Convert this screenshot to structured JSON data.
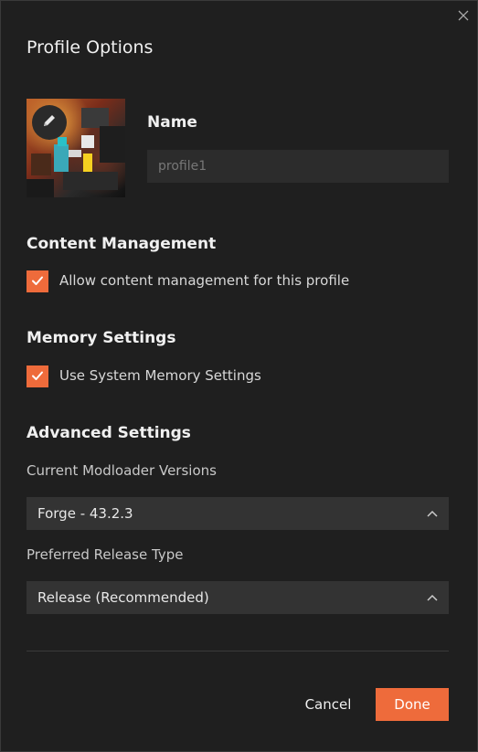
{
  "dialog": {
    "title": "Profile Options"
  },
  "profile": {
    "name_label": "Name",
    "name_value": "",
    "name_placeholder": "profile1"
  },
  "content_management": {
    "title": "Content Management",
    "checkbox_label": "Allow content management for this profile",
    "checked": true
  },
  "memory_settings": {
    "title": "Memory Settings",
    "checkbox_label": "Use System Memory Settings",
    "checked": true
  },
  "advanced_settings": {
    "title": "Advanced Settings",
    "modloader_label": "Current Modloader Versions",
    "modloader_value": "Forge - 43.2.3",
    "release_label": "Preferred Release Type",
    "release_value": "Release (Recommended)"
  },
  "actions": {
    "cancel_label": "Cancel",
    "done_label": "Done"
  },
  "colors": {
    "accent": "#ee6b3b",
    "background": "#1f1f1f",
    "input_bg": "#2c2c2c",
    "select_bg": "#333333"
  },
  "icons": {
    "close": "close-icon",
    "edit": "pencil-icon",
    "check": "check-icon",
    "chevron": "chevron-up-icon"
  }
}
